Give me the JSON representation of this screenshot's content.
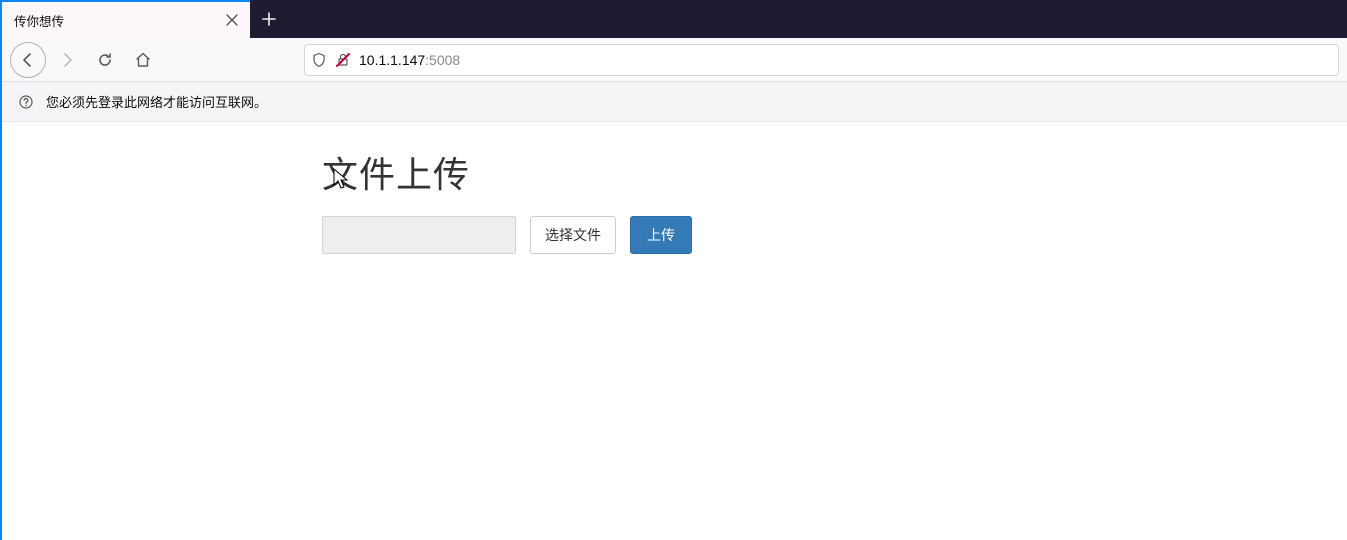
{
  "browser": {
    "tab_title": "传你想传",
    "url_host": "10.1.1.147",
    "url_port": ":5008"
  },
  "infobar": {
    "message": "您必须先登录此网络才能访问互联网。"
  },
  "page": {
    "heading": "文件上传",
    "choose_label": "选择文件",
    "upload_label": "上传"
  }
}
